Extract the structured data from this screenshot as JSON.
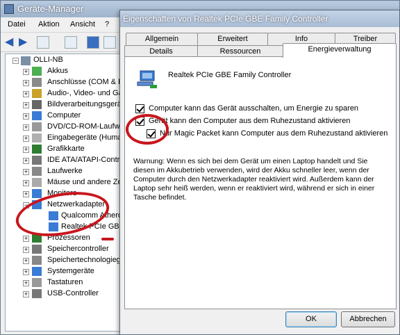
{
  "device_manager": {
    "title": "Geräte-Manager",
    "menu": [
      "Datei",
      "Aktion",
      "Ansicht",
      "?"
    ],
    "tree": {
      "root": "OLLI-NB",
      "items": [
        "Akkus",
        "Anschlüsse (COM & LPT)",
        "Audio-, Video- und Gamecontroller",
        "Bildverarbeitungsgeräte",
        "Computer",
        "DVD/CD-ROM-Laufwerke",
        "Eingabegeräte (Human Interface Devices)",
        "Grafikkarte",
        "IDE ATA/ATAPI-Controller",
        "Laufwerke",
        "Mäuse und andere Zeigegeräte",
        "Monitore",
        "Netzwerkadapter",
        "Prozessoren",
        "Speichercontroller",
        "Speichertechnologiegeräte",
        "Systemgeräte",
        "Tastaturen",
        "USB-Controller"
      ],
      "network_children": [
        "Qualcomm Atheros",
        "Realtek PCIe GBE"
      ]
    }
  },
  "dialog": {
    "title": "Eigenschaften von Realtek PCIe GBE Family Controller",
    "tabs_row1": [
      "Allgemein",
      "Erweitert",
      "Info",
      "Treiber"
    ],
    "tabs_row2": [
      "Details",
      "Ressourcen",
      "Energieverwaltung"
    ],
    "active_tab": "Energieverwaltung",
    "device_name": "Realtek PCIe GBE Family Controller",
    "options": [
      {
        "label": "Computer kann das Gerät ausschalten, um Energie zu sparen",
        "checked": true
      },
      {
        "label": "Gerät kann den Computer aus dem Ruhezustand aktivieren",
        "checked": true
      },
      {
        "label": "Nur Magic Packet kann Computer aus dem Ruhezustand aktivieren",
        "checked": true
      }
    ],
    "warning": "Warnung: Wenn es sich bei dem Gerät um einen Laptop handelt und Sie diesen im Akkubetrieb verwenden, wird der Akku schneller leer, wenn der Computer durch den Netzwerkadapter reaktiviert wird. Außerdem kann der Laptop sehr heiß werden, wenn er reaktiviert wird, während er sich in einer Tasche befindet.",
    "ok_label": "OK",
    "cancel_label": "Abbrechen"
  },
  "colors": {
    "annotation": "#c8161d",
    "titlebar": "#a9bdd4"
  }
}
